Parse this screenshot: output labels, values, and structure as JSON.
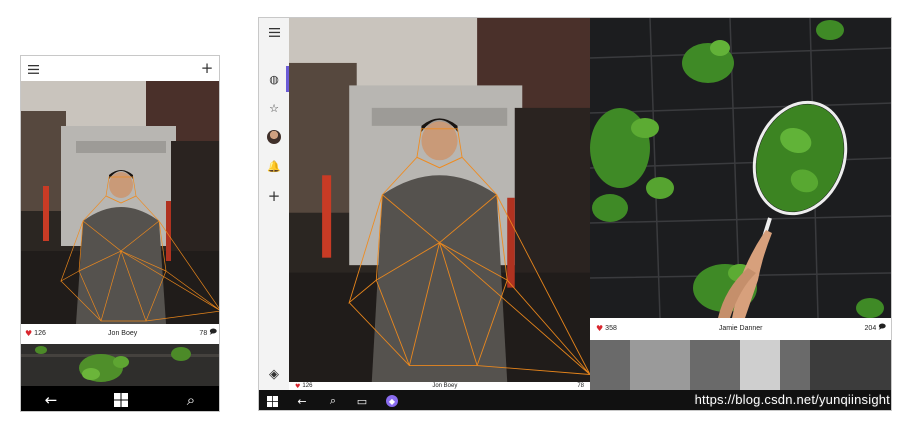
{
  "phone": {
    "top_bar": {
      "menu_icon": "hamburger-menu-icon",
      "add_icon": "plus-icon",
      "add_glyph": "+"
    },
    "post": {
      "likes": "126",
      "author": "Jon Boey",
      "comments": "78"
    },
    "nav_bar": {
      "back_glyph": "←",
      "home_icon": "windows-logo-icon",
      "search_glyph": "⌕"
    }
  },
  "tablet": {
    "rail": {
      "menu_icon": "hamburger-menu-icon",
      "items": [
        {
          "name": "explore",
          "glyph": "◍"
        },
        {
          "name": "favorites",
          "glyph": "☆"
        },
        {
          "name": "profile",
          "glyph": ""
        },
        {
          "name": "notifications",
          "glyph": "🔔"
        },
        {
          "name": "add",
          "glyph": "+"
        }
      ],
      "bottom_glyph": "◈"
    },
    "post_a": {
      "likes": "126",
      "author": "Jon Boey",
      "comments": "78"
    },
    "post_b": {
      "likes": "358",
      "author": "Jamie Danner",
      "comments": "204"
    },
    "taskbar": {
      "back_glyph": "←",
      "search_glyph": "⌕",
      "taskview_glyph": "▭",
      "cortana_glyph": "◆"
    }
  },
  "watermark": "https://blog.csdn.net/yunqiinsight",
  "colors": {
    "accent": "#6b5bd6",
    "heart": "#d9262e",
    "mesh": "#f08a1c"
  }
}
